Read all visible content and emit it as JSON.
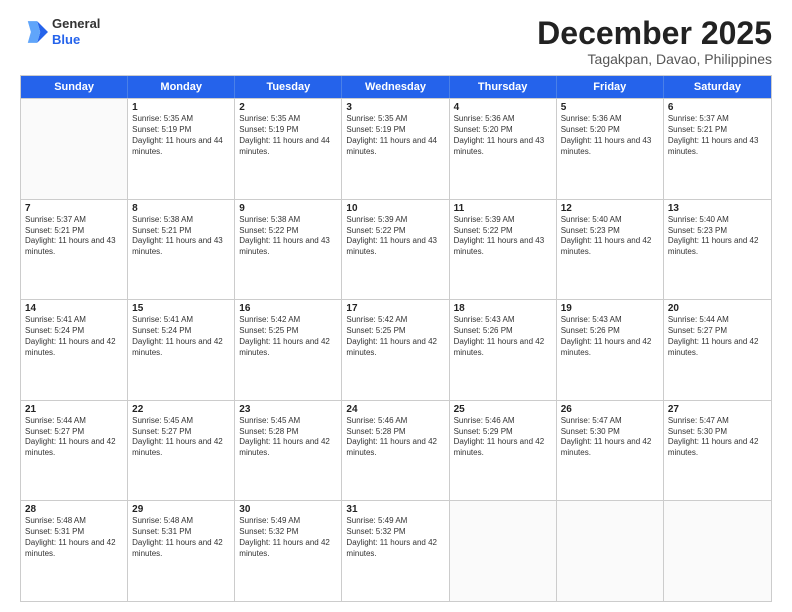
{
  "logo": {
    "general": "General",
    "blue": "Blue"
  },
  "title": "December 2025",
  "subtitle": "Tagakpan, Davao, Philippines",
  "headers": [
    "Sunday",
    "Monday",
    "Tuesday",
    "Wednesday",
    "Thursday",
    "Friday",
    "Saturday"
  ],
  "weeks": [
    [
      {
        "day": "",
        "sunrise": "",
        "sunset": "",
        "daylight": ""
      },
      {
        "day": "1",
        "sunrise": "Sunrise: 5:35 AM",
        "sunset": "Sunset: 5:19 PM",
        "daylight": "Daylight: 11 hours and 44 minutes."
      },
      {
        "day": "2",
        "sunrise": "Sunrise: 5:35 AM",
        "sunset": "Sunset: 5:19 PM",
        "daylight": "Daylight: 11 hours and 44 minutes."
      },
      {
        "day": "3",
        "sunrise": "Sunrise: 5:35 AM",
        "sunset": "Sunset: 5:19 PM",
        "daylight": "Daylight: 11 hours and 44 minutes."
      },
      {
        "day": "4",
        "sunrise": "Sunrise: 5:36 AM",
        "sunset": "Sunset: 5:20 PM",
        "daylight": "Daylight: 11 hours and 43 minutes."
      },
      {
        "day": "5",
        "sunrise": "Sunrise: 5:36 AM",
        "sunset": "Sunset: 5:20 PM",
        "daylight": "Daylight: 11 hours and 43 minutes."
      },
      {
        "day": "6",
        "sunrise": "Sunrise: 5:37 AM",
        "sunset": "Sunset: 5:21 PM",
        "daylight": "Daylight: 11 hours and 43 minutes."
      }
    ],
    [
      {
        "day": "7",
        "sunrise": "Sunrise: 5:37 AM",
        "sunset": "Sunset: 5:21 PM",
        "daylight": "Daylight: 11 hours and 43 minutes."
      },
      {
        "day": "8",
        "sunrise": "Sunrise: 5:38 AM",
        "sunset": "Sunset: 5:21 PM",
        "daylight": "Daylight: 11 hours and 43 minutes."
      },
      {
        "day": "9",
        "sunrise": "Sunrise: 5:38 AM",
        "sunset": "Sunset: 5:22 PM",
        "daylight": "Daylight: 11 hours and 43 minutes."
      },
      {
        "day": "10",
        "sunrise": "Sunrise: 5:39 AM",
        "sunset": "Sunset: 5:22 PM",
        "daylight": "Daylight: 11 hours and 43 minutes."
      },
      {
        "day": "11",
        "sunrise": "Sunrise: 5:39 AM",
        "sunset": "Sunset: 5:22 PM",
        "daylight": "Daylight: 11 hours and 43 minutes."
      },
      {
        "day": "12",
        "sunrise": "Sunrise: 5:40 AM",
        "sunset": "Sunset: 5:23 PM",
        "daylight": "Daylight: 11 hours and 42 minutes."
      },
      {
        "day": "13",
        "sunrise": "Sunrise: 5:40 AM",
        "sunset": "Sunset: 5:23 PM",
        "daylight": "Daylight: 11 hours and 42 minutes."
      }
    ],
    [
      {
        "day": "14",
        "sunrise": "Sunrise: 5:41 AM",
        "sunset": "Sunset: 5:24 PM",
        "daylight": "Daylight: 11 hours and 42 minutes."
      },
      {
        "day": "15",
        "sunrise": "Sunrise: 5:41 AM",
        "sunset": "Sunset: 5:24 PM",
        "daylight": "Daylight: 11 hours and 42 minutes."
      },
      {
        "day": "16",
        "sunrise": "Sunrise: 5:42 AM",
        "sunset": "Sunset: 5:25 PM",
        "daylight": "Daylight: 11 hours and 42 minutes."
      },
      {
        "day": "17",
        "sunrise": "Sunrise: 5:42 AM",
        "sunset": "Sunset: 5:25 PM",
        "daylight": "Daylight: 11 hours and 42 minutes."
      },
      {
        "day": "18",
        "sunrise": "Sunrise: 5:43 AM",
        "sunset": "Sunset: 5:26 PM",
        "daylight": "Daylight: 11 hours and 42 minutes."
      },
      {
        "day": "19",
        "sunrise": "Sunrise: 5:43 AM",
        "sunset": "Sunset: 5:26 PM",
        "daylight": "Daylight: 11 hours and 42 minutes."
      },
      {
        "day": "20",
        "sunrise": "Sunrise: 5:44 AM",
        "sunset": "Sunset: 5:27 PM",
        "daylight": "Daylight: 11 hours and 42 minutes."
      }
    ],
    [
      {
        "day": "21",
        "sunrise": "Sunrise: 5:44 AM",
        "sunset": "Sunset: 5:27 PM",
        "daylight": "Daylight: 11 hours and 42 minutes."
      },
      {
        "day": "22",
        "sunrise": "Sunrise: 5:45 AM",
        "sunset": "Sunset: 5:27 PM",
        "daylight": "Daylight: 11 hours and 42 minutes."
      },
      {
        "day": "23",
        "sunrise": "Sunrise: 5:45 AM",
        "sunset": "Sunset: 5:28 PM",
        "daylight": "Daylight: 11 hours and 42 minutes."
      },
      {
        "day": "24",
        "sunrise": "Sunrise: 5:46 AM",
        "sunset": "Sunset: 5:28 PM",
        "daylight": "Daylight: 11 hours and 42 minutes."
      },
      {
        "day": "25",
        "sunrise": "Sunrise: 5:46 AM",
        "sunset": "Sunset: 5:29 PM",
        "daylight": "Daylight: 11 hours and 42 minutes."
      },
      {
        "day": "26",
        "sunrise": "Sunrise: 5:47 AM",
        "sunset": "Sunset: 5:30 PM",
        "daylight": "Daylight: 11 hours and 42 minutes."
      },
      {
        "day": "27",
        "sunrise": "Sunrise: 5:47 AM",
        "sunset": "Sunset: 5:30 PM",
        "daylight": "Daylight: 11 hours and 42 minutes."
      }
    ],
    [
      {
        "day": "28",
        "sunrise": "Sunrise: 5:48 AM",
        "sunset": "Sunset: 5:31 PM",
        "daylight": "Daylight: 11 hours and 42 minutes."
      },
      {
        "day": "29",
        "sunrise": "Sunrise: 5:48 AM",
        "sunset": "Sunset: 5:31 PM",
        "daylight": "Daylight: 11 hours and 42 minutes."
      },
      {
        "day": "30",
        "sunrise": "Sunrise: 5:49 AM",
        "sunset": "Sunset: 5:32 PM",
        "daylight": "Daylight: 11 hours and 42 minutes."
      },
      {
        "day": "31",
        "sunrise": "Sunrise: 5:49 AM",
        "sunset": "Sunset: 5:32 PM",
        "daylight": "Daylight: 11 hours and 42 minutes."
      },
      {
        "day": "",
        "sunrise": "",
        "sunset": "",
        "daylight": ""
      },
      {
        "day": "",
        "sunrise": "",
        "sunset": "",
        "daylight": ""
      },
      {
        "day": "",
        "sunrise": "",
        "sunset": "",
        "daylight": ""
      }
    ]
  ]
}
